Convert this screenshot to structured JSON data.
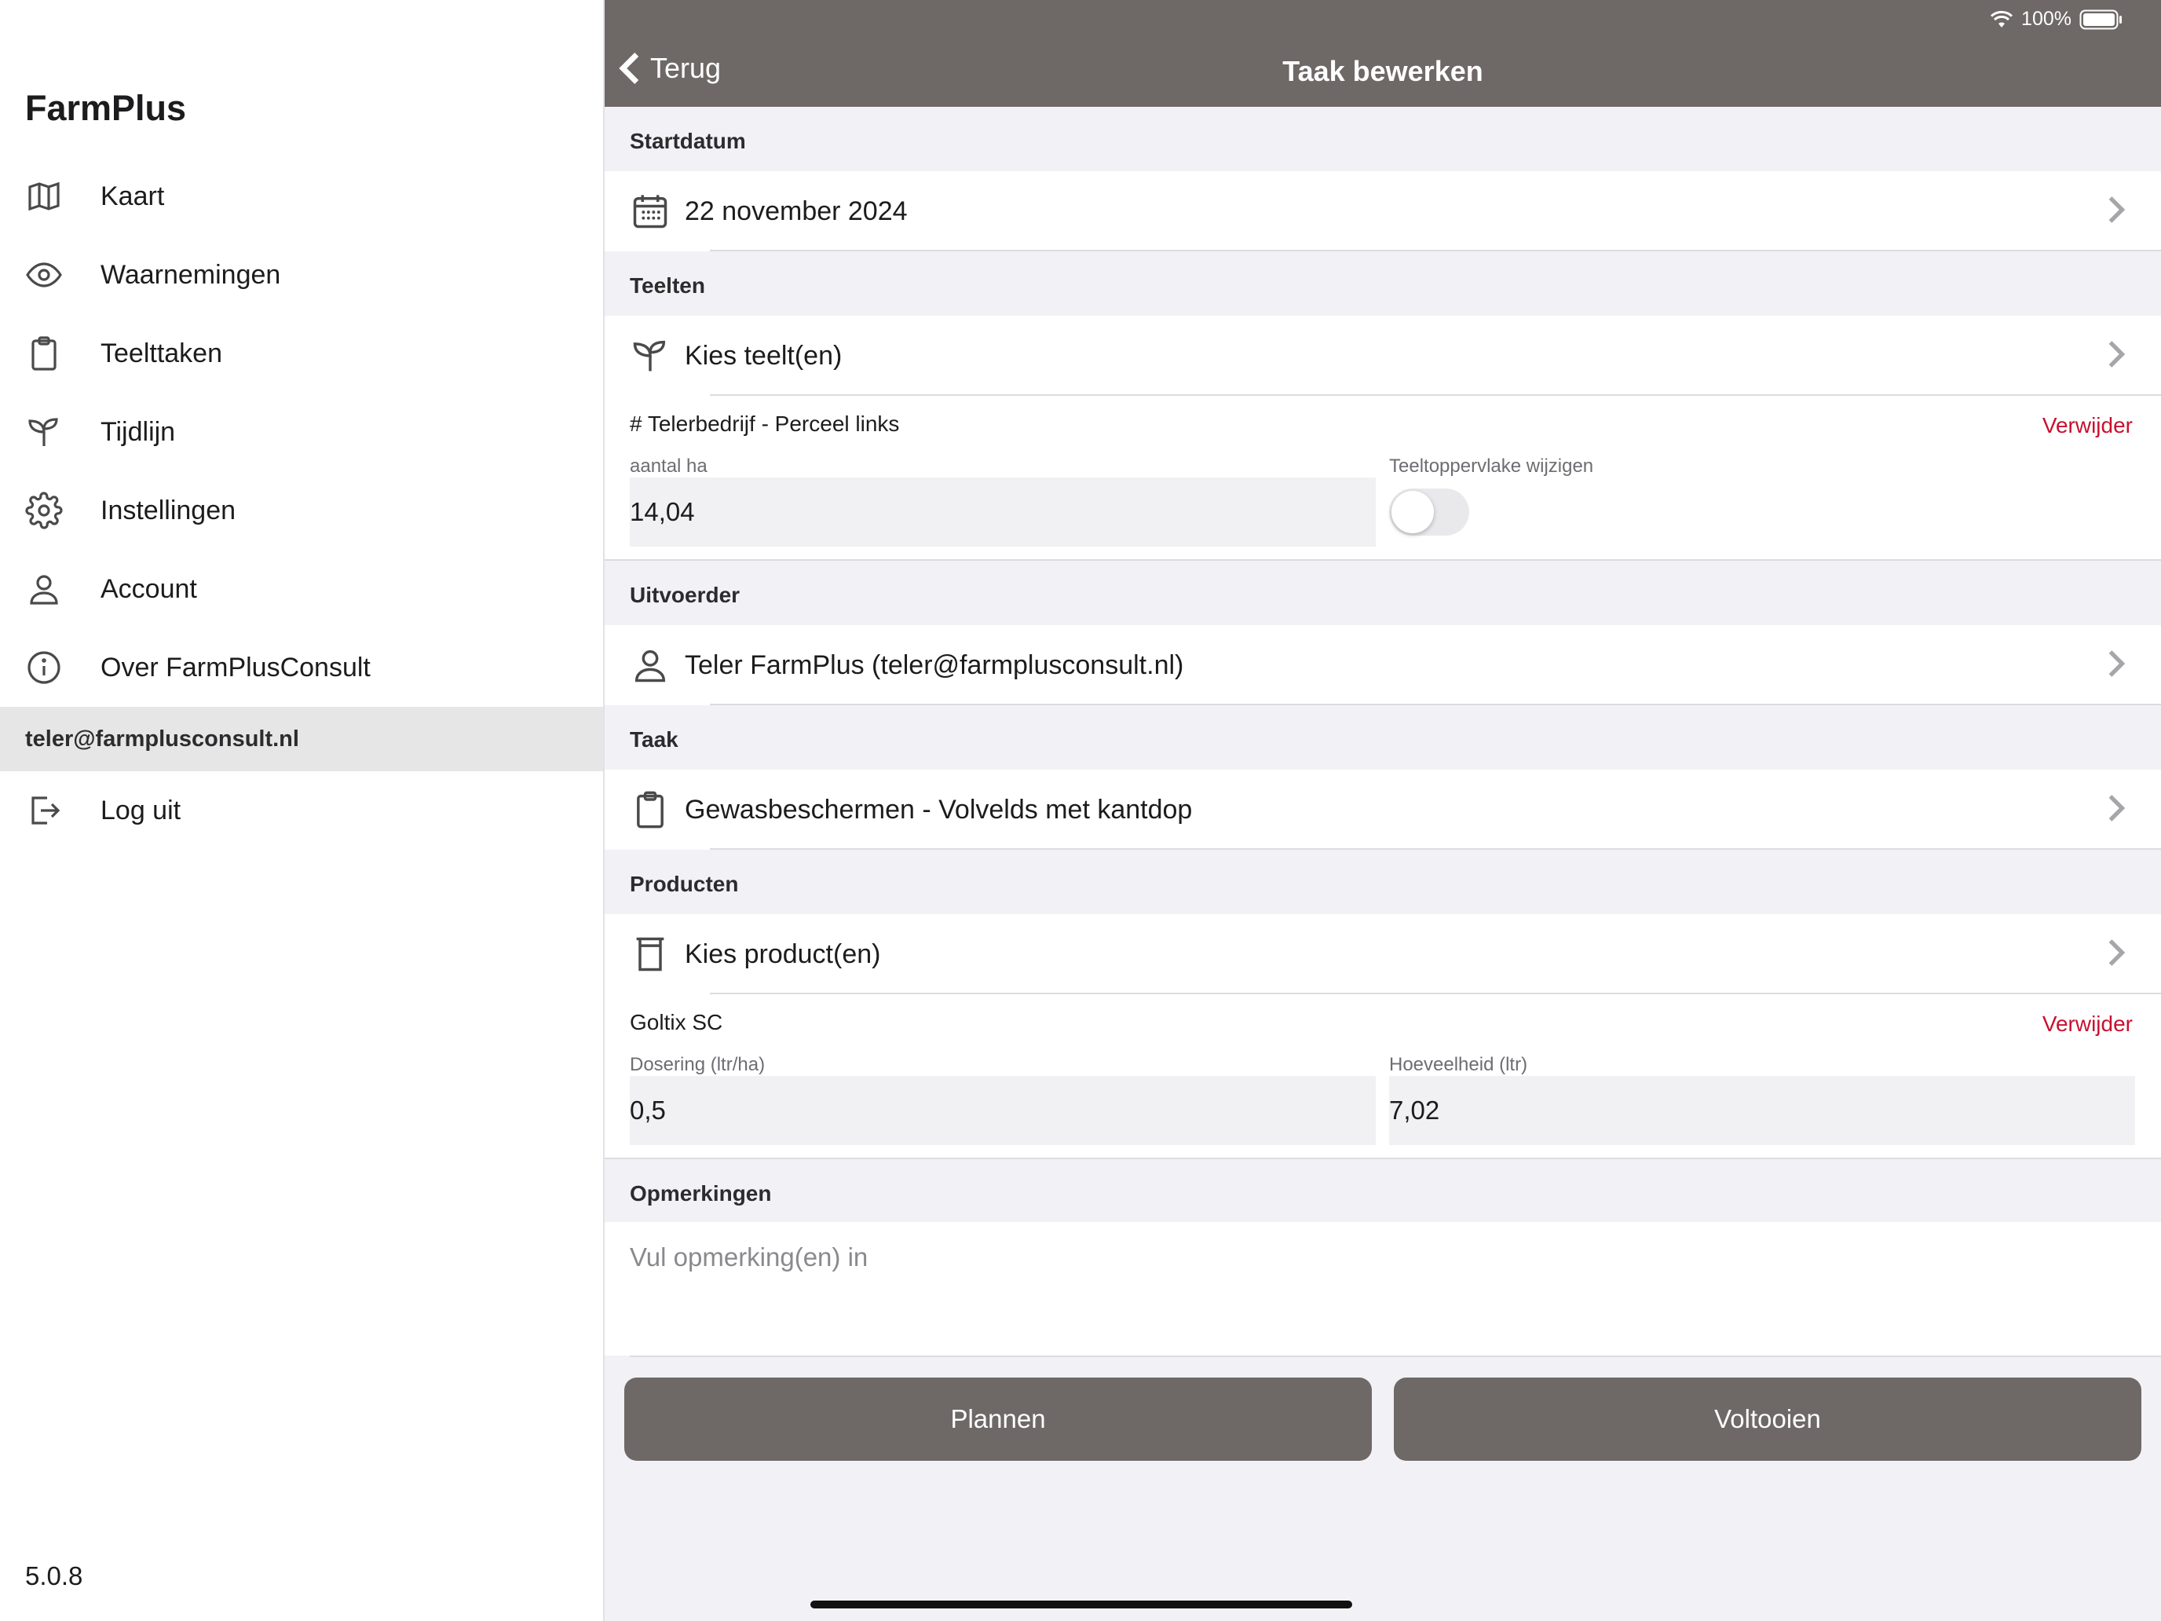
{
  "status_bar": {
    "battery": "100%"
  },
  "sidebar": {
    "app_title": "FarmPlus",
    "items": [
      {
        "label": "Kaart",
        "icon": "map-icon"
      },
      {
        "label": "Waarnemingen",
        "icon": "eye-icon"
      },
      {
        "label": "Teelttaken",
        "icon": "clipboard-icon"
      },
      {
        "label": "Tijdlijn",
        "icon": "sprout-icon"
      },
      {
        "label": "Instellingen",
        "icon": "gear-icon"
      },
      {
        "label": "Account",
        "icon": "user-icon"
      },
      {
        "label": "Over FarmPlusConsult",
        "icon": "info-icon"
      }
    ],
    "user_email": "teler@farmplusconsult.nl",
    "logout_label": "Log uit",
    "version": "5.0.8"
  },
  "header": {
    "back_label": "Terug",
    "title": "Taak bewerken"
  },
  "startdatum": {
    "header": "Startdatum",
    "value": "22 november 2024"
  },
  "teelten": {
    "header": "Teelten",
    "choose_label": "Kies teelt(en)",
    "selected": {
      "title": "# Telerbedrijf - Perceel links",
      "remove_label": "Verwijder",
      "area_label": "aantal ha",
      "area_value": "14,04",
      "toggle_label": "Teeltoppervlake wijzigen"
    }
  },
  "uitvoerder": {
    "header": "Uitvoerder",
    "value": "Teler FarmPlus (teler@farmplusconsult.nl)"
  },
  "taak": {
    "header": "Taak",
    "value": "Gewasbeschermen - Volvelds met kantdop"
  },
  "producten": {
    "header": "Producten",
    "choose_label": "Kies product(en)",
    "selected": {
      "title": "Goltix SC",
      "remove_label": "Verwijder",
      "dose_label": "Dosering (ltr/ha)",
      "dose_value": "0,5",
      "amount_label": "Hoeveelheid (ltr)",
      "amount_value": "7,02"
    }
  },
  "opmerkingen": {
    "header": "Opmerkingen",
    "placeholder": "Vul opmerking(en) in"
  },
  "actions": {
    "plan_label": "Plannen",
    "complete_label": "Voltooien"
  }
}
